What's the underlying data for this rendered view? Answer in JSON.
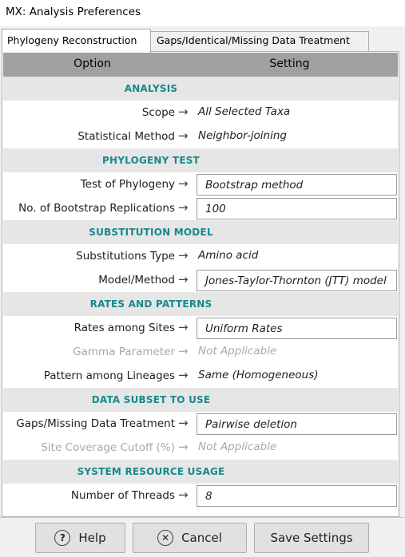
{
  "window": {
    "title": "MX: Analysis Preferences"
  },
  "tabs": [
    {
      "label": "Phylogeny Reconstruction",
      "active": true
    },
    {
      "label": "Gaps/Identical/Missing Data Treatment",
      "active": false
    }
  ],
  "table": {
    "header_option": "Option",
    "header_setting": "Setting",
    "arrow_glyph": "→",
    "rows": [
      {
        "type": "section",
        "label": "ANALYSIS"
      },
      {
        "type": "option",
        "option": "Scope",
        "value": "All Selected Taxa",
        "editable": false,
        "enabled": true
      },
      {
        "type": "option",
        "option": "Statistical Method",
        "value": "Neighbor-joining",
        "editable": false,
        "enabled": true
      },
      {
        "type": "section",
        "label": "PHYLOGENY TEST"
      },
      {
        "type": "option",
        "option": "Test of Phylogeny",
        "value": "Bootstrap method",
        "editable": true,
        "enabled": true
      },
      {
        "type": "option",
        "option": "No. of Bootstrap Replications",
        "value": "100",
        "editable": true,
        "enabled": true
      },
      {
        "type": "section",
        "label": "SUBSTITUTION MODEL"
      },
      {
        "type": "option",
        "option": "Substitutions Type",
        "value": "Amino acid",
        "editable": false,
        "enabled": true
      },
      {
        "type": "option",
        "option": "Model/Method",
        "value": "Jones-Taylor-Thornton (JTT) model",
        "editable": true,
        "enabled": true
      },
      {
        "type": "section",
        "label": "RATES AND PATTERNS"
      },
      {
        "type": "option",
        "option": "Rates among Sites",
        "value": "Uniform Rates",
        "editable": true,
        "enabled": true
      },
      {
        "type": "option",
        "option": "Gamma Parameter",
        "value": "Not Applicable",
        "editable": false,
        "enabled": false
      },
      {
        "type": "option",
        "option": "Pattern among Lineages",
        "value": "Same (Homogeneous)",
        "editable": false,
        "enabled": true
      },
      {
        "type": "section",
        "label": "DATA SUBSET TO USE"
      },
      {
        "type": "option",
        "option": "Gaps/Missing Data Treatment",
        "value": "Pairwise deletion",
        "editable": true,
        "enabled": true
      },
      {
        "type": "option",
        "option": "Site Coverage Cutoff (%)",
        "value": "Not Applicable",
        "editable": false,
        "enabled": false
      },
      {
        "type": "section",
        "label": "SYSTEM RESOURCE USAGE"
      },
      {
        "type": "option",
        "option": "Number of Threads",
        "value": "8",
        "editable": true,
        "enabled": true
      }
    ]
  },
  "buttons": {
    "help_label": "Help",
    "help_icon": "?",
    "cancel_label": "Cancel",
    "cancel_icon": "✕",
    "save_label": "Save Settings"
  },
  "colors": {
    "section_text": "#17898c",
    "header_bg": "#a0a0a0",
    "section_bg": "#e6e6e6",
    "disabled_text": "#a9a9a9"
  }
}
